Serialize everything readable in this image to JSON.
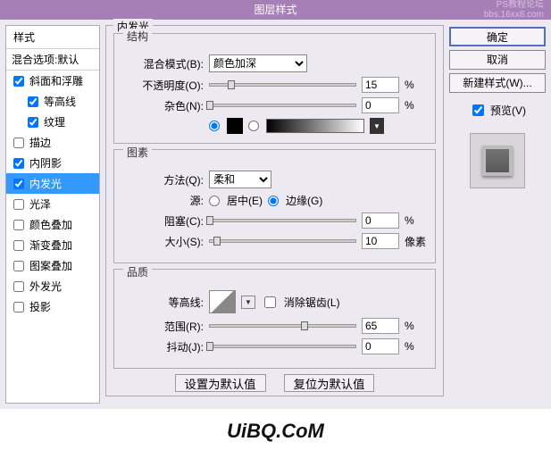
{
  "title": "图层样式",
  "watermark_top_a": "PS教程论坛",
  "watermark_top_b": "bbs.16xx8.com",
  "watermark_bottom": "UiBQ.CoM",
  "left": {
    "header": "样式",
    "mix": "混合选项:默认",
    "items": [
      {
        "label": "斜面和浮雕",
        "checked": true,
        "indent": 0
      },
      {
        "label": "等高线",
        "checked": true,
        "indent": 1
      },
      {
        "label": "纹理",
        "checked": true,
        "indent": 1
      },
      {
        "label": "描边",
        "checked": false,
        "indent": 0
      },
      {
        "label": "内阴影",
        "checked": true,
        "indent": 0
      },
      {
        "label": "内发光",
        "checked": true,
        "indent": 0,
        "selected": true
      },
      {
        "label": "光泽",
        "checked": false,
        "indent": 0
      },
      {
        "label": "颜色叠加",
        "checked": false,
        "indent": 0
      },
      {
        "label": "渐变叠加",
        "checked": false,
        "indent": 0
      },
      {
        "label": "图案叠加",
        "checked": false,
        "indent": 0
      },
      {
        "label": "外发光",
        "checked": false,
        "indent": 0
      },
      {
        "label": "投影",
        "checked": false,
        "indent": 0
      }
    ]
  },
  "center": {
    "legend_main": "内发光",
    "structure": {
      "legend": "结构",
      "blend_label": "混合模式(B):",
      "blend_value": "颜色加深",
      "opacity_label": "不透明度(O):",
      "opacity_value": "15",
      "opacity_unit": "%",
      "noise_label": "杂色(N):",
      "noise_value": "0",
      "noise_unit": "%"
    },
    "elements": {
      "legend": "图素",
      "method_label": "方法(Q):",
      "method_value": "柔和",
      "source_label": "源:",
      "source_center": "居中(E)",
      "source_edge": "边缘(G)",
      "choke_label": "阻塞(C):",
      "choke_value": "0",
      "choke_unit": "%",
      "size_label": "大小(S):",
      "size_value": "10",
      "size_unit": "像素"
    },
    "quality": {
      "legend": "品质",
      "contour_label": "等高线:",
      "antialias": "消除锯齿(L)",
      "range_label": "范围(R):",
      "range_value": "65",
      "range_unit": "%",
      "jitter_label": "抖动(J):",
      "jitter_value": "0",
      "jitter_unit": "%"
    },
    "btn_default": "设置为默认值",
    "btn_reset": "复位为默认值"
  },
  "right": {
    "ok": "确定",
    "cancel": "取消",
    "new_style": "新建样式(W)...",
    "preview": "预览(V)"
  }
}
